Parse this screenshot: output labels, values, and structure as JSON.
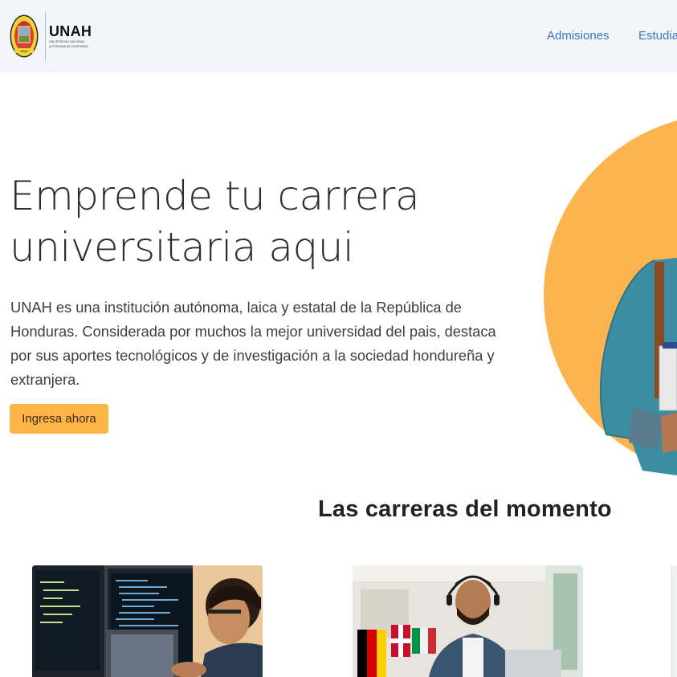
{
  "brand": {
    "name": "UNAH",
    "subtitle_line1": "UNIVERSIDAD NACIONAL",
    "subtitle_line2": "AUTÓNOMA DE HONDURAS",
    "seal_label": "UNAH"
  },
  "nav": {
    "items": [
      {
        "label": "Admisiones"
      },
      {
        "label": "Estudia"
      }
    ]
  },
  "hero": {
    "title_line1": "Emprende tu carrera",
    "title_line2": "universitaria aqui",
    "description": "UNAH es una institución autónoma, laica y estatal de la República de Honduras. Considerada por muchos la mejor universidad del pais, destaca por sus aportes tecnológicos y de investigación a la sociedad hondureña y extranjera.",
    "cta_label": "Ingresa ahora",
    "image_icon": "student-photo"
  },
  "careers": {
    "title": "Las carreras del momento",
    "cards": [
      {
        "image_icon": "programmer-photo"
      },
      {
        "image_icon": "languages-student-photo"
      },
      {
        "image_icon": "card-photo"
      }
    ]
  },
  "colors": {
    "accent": "#fdb548",
    "nav_link": "#3b74c1",
    "navbar_bg": "#f2f5fa",
    "circle": "#fcb54e"
  }
}
